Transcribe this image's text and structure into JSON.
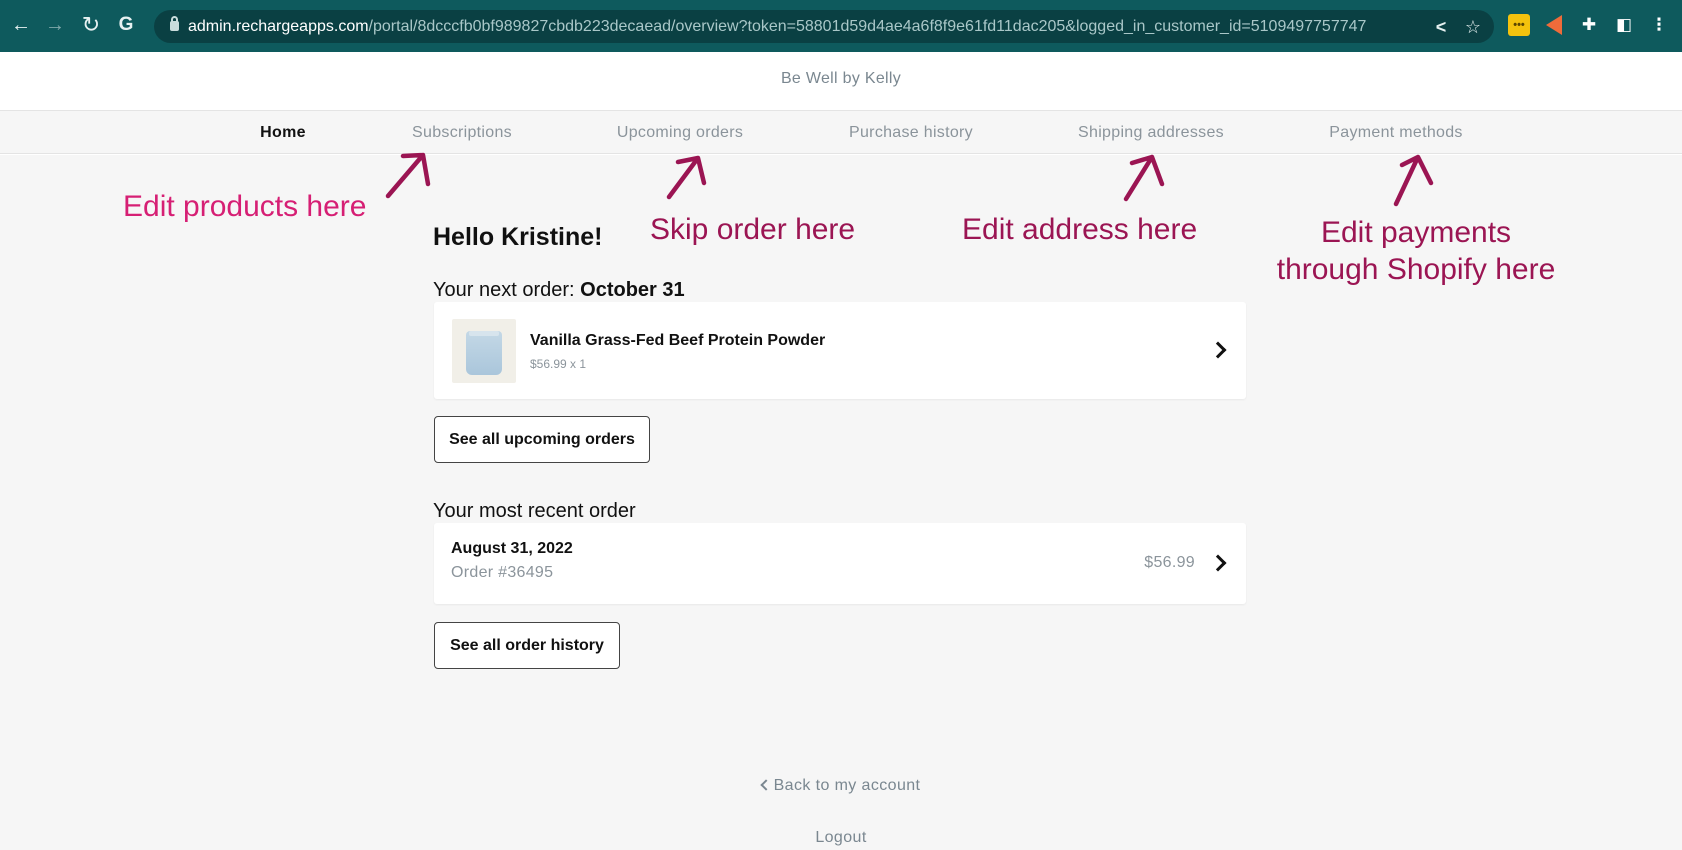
{
  "browser": {
    "url_host": "admin.rechargeapps.com",
    "url_rest": "/portal/8dcccfb0bf989827cbdb223decaead/overview?token=58801d59d4ae4a6f8f9e61fd11dac205&logged_in_customer_id=5109497757747",
    "back_glyph": "←",
    "forward_glyph": "→",
    "reload_glyph": "↻",
    "google_glyph": "G",
    "share_glyph": "<",
    "star_glyph": "☆",
    "extension_glyph": "✚",
    "sidepanel_glyph": "◧",
    "menu_glyph": "⋮",
    "theme_color": "#0e5a5d"
  },
  "store": {
    "name": "Be Well by Kelly"
  },
  "nav": {
    "items": [
      {
        "label": "Home",
        "active": true
      },
      {
        "label": "Subscriptions"
      },
      {
        "label": "Upcoming orders"
      },
      {
        "label": "Purchase history"
      },
      {
        "label": "Shipping addresses"
      },
      {
        "label": "Payment methods"
      }
    ]
  },
  "greeting": "Hello Kristine!",
  "next_order": {
    "label_prefix": "Your next order: ",
    "date": "October 31",
    "product_name": "Vanilla Grass-Fed Beef Protein Powder",
    "product_price": "$56.99 x 1"
  },
  "buttons": {
    "see_upcoming": "See all upcoming orders",
    "see_history": "See all order history"
  },
  "recent_order": {
    "label": "Your most recent order",
    "date": "August 31, 2022",
    "number": "Order #36495",
    "total": "$56.99"
  },
  "footer": {
    "back": "Back to my account",
    "logout": "Logout"
  },
  "annotations": {
    "edit_products": "Edit products here",
    "skip_order": "Skip order here",
    "edit_address": "Edit address here",
    "edit_payments_line1": "Edit payments",
    "edit_payments_line2": "through Shopify here",
    "color_pink": "#d61f74",
    "color_plum": "#9b1553"
  }
}
